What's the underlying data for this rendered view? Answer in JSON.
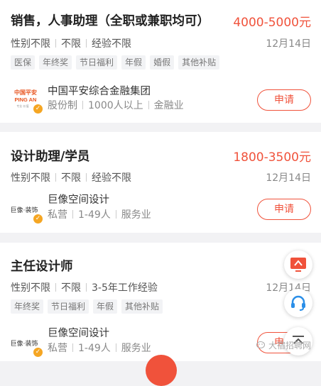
{
  "jobs": [
    {
      "title": "销售，人事助理（全职或兼职均可）",
      "salary": "4000-5000元",
      "requirements": [
        "性别不限",
        "不限",
        "经验不限"
      ],
      "date": "12月14日",
      "tags": [
        "医保",
        "年终奖",
        "节日福利",
        "年假",
        "婚假",
        "其他补贴"
      ],
      "company": "中国平安综合金融集团",
      "company_info": [
        "股份制",
        "1000人以上",
        "金融业"
      ],
      "logo_text": "中国平安 PING AN",
      "apply_label": "申请"
    },
    {
      "title": "设计助理/学员",
      "salary": "1800-3500元",
      "requirements": [
        "性别不限",
        "不限",
        "经验不限"
      ],
      "date": "12月14日",
      "tags": [],
      "company": "巨像空间设计",
      "company_info": [
        "私营",
        "1-49人",
        "服务业"
      ],
      "logo_text": "巨像·装饰",
      "apply_label": "申请"
    },
    {
      "title": "主任设计师",
      "salary": "",
      "requirements": [
        "性别不限",
        "不限",
        "3-5年工作经验"
      ],
      "date": "12月14日",
      "tags": [
        "年终奖",
        "节日福利",
        "年假",
        "其他补贴"
      ],
      "company": "巨像空间设计",
      "company_info": [
        "私营",
        "1-49人",
        "服务业"
      ],
      "logo_text": "巨像·装饰",
      "apply_label": "申请"
    }
  ],
  "watermark": "大宿招聘网",
  "colors": {
    "accent": "#f0523b",
    "badge": "#f5a623"
  }
}
